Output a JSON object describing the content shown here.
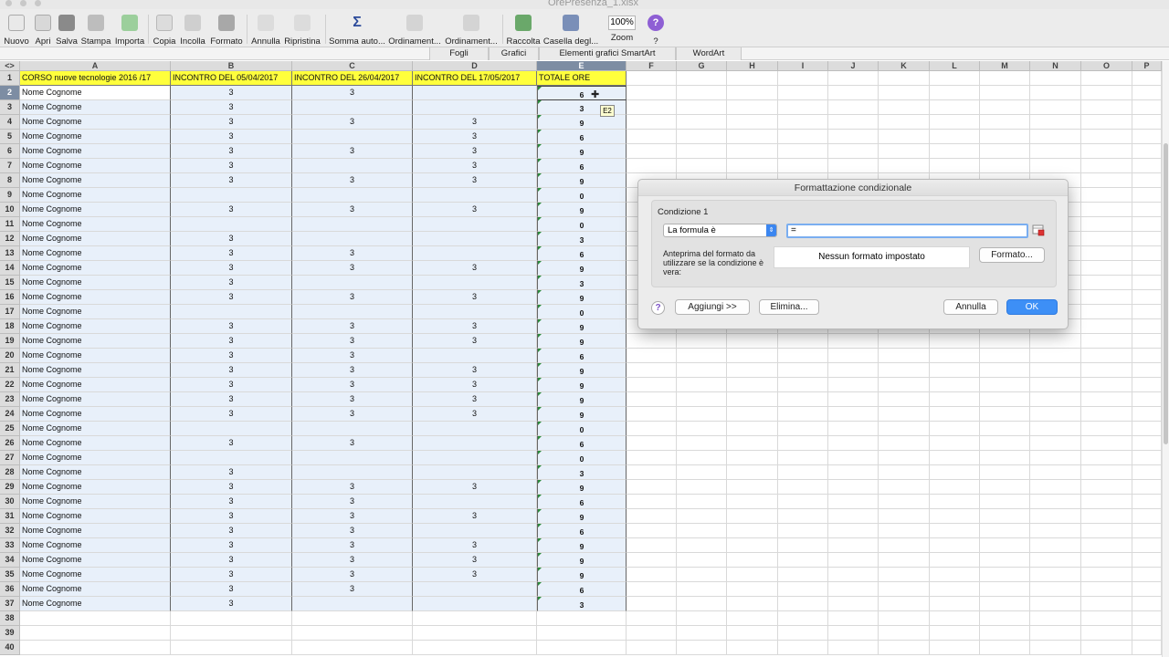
{
  "window": {
    "title": "OrePresenza_1.xlsx"
  },
  "toolbar": {
    "buttons": [
      {
        "label": "Nuovo",
        "icon": "new-document-icon"
      },
      {
        "label": "Apri",
        "icon": "open-folder-icon"
      },
      {
        "label": "Salva",
        "icon": "save-icon"
      },
      {
        "label": "Stampa",
        "icon": "print-icon"
      },
      {
        "label": "Importa",
        "icon": "import-icon"
      },
      {
        "label": "Copia",
        "icon": "copy-icon"
      },
      {
        "label": "Incolla",
        "icon": "paste-icon"
      },
      {
        "label": "Formato",
        "icon": "format-brush-icon"
      },
      {
        "label": "Annulla",
        "icon": "undo-icon"
      },
      {
        "label": "Ripristina",
        "icon": "redo-icon"
      },
      {
        "label": "Somma auto...",
        "icon": "sigma-icon"
      },
      {
        "label": "Ordinament...",
        "icon": "sort-ascending-icon"
      },
      {
        "label": "Ordinament...",
        "icon": "sort-descending-icon"
      },
      {
        "label": "Raccolta",
        "icon": "gallery-icon"
      },
      {
        "label": "Casella degl...",
        "icon": "toolbox-icon"
      },
      {
        "label": "Zoom",
        "icon": "zoom-icon"
      },
      {
        "label": "?",
        "icon": "help-icon"
      }
    ],
    "zoom_value": "100%"
  },
  "ribbon": {
    "tabs": [
      "Fogli",
      "Grafici",
      "Elementi grafici SmartArt",
      "WordArt"
    ]
  },
  "sheet": {
    "corner": "<>",
    "columns": [
      "A",
      "B",
      "C",
      "D",
      "E",
      "F",
      "G",
      "H",
      "I",
      "J",
      "K",
      "L",
      "M",
      "N",
      "O",
      "P"
    ],
    "headers": [
      "CORSO nuove tecnologie  2016 /17",
      "INCONTRO DEL 05/04/2017",
      "INCONTRO DEL 26/04/2017",
      "INCONTRO DEL 17/05/2017",
      "TOTALE ORE"
    ],
    "rows": [
      {
        "n": "2",
        "name": "Nome Cognome",
        "b": "3",
        "c": "3",
        "d": "",
        "e": "6"
      },
      {
        "n": "3",
        "name": "Nome Cognome",
        "b": "3",
        "c": "",
        "d": "",
        "e": "3"
      },
      {
        "n": "4",
        "name": "Nome Cognome",
        "b": "3",
        "c": "3",
        "d": "3",
        "e": "9"
      },
      {
        "n": "5",
        "name": "Nome Cognome",
        "b": "3",
        "c": "",
        "d": "3",
        "e": "6"
      },
      {
        "n": "6",
        "name": "Nome Cognome",
        "b": "3",
        "c": "3",
        "d": "3",
        "e": "9"
      },
      {
        "n": "7",
        "name": "Nome Cognome",
        "b": "3",
        "c": "",
        "d": "3",
        "e": "6"
      },
      {
        "n": "8",
        "name": "Nome Cognome",
        "b": "3",
        "c": "3",
        "d": "3",
        "e": "9"
      },
      {
        "n": "9",
        "name": "Nome Cognome",
        "b": "",
        "c": "",
        "d": "",
        "e": "0"
      },
      {
        "n": "10",
        "name": "Nome Cognome",
        "b": "3",
        "c": "3",
        "d": "3",
        "e": "9"
      },
      {
        "n": "11",
        "name": "Nome Cognome",
        "b": "",
        "c": "",
        "d": "",
        "e": "0"
      },
      {
        "n": "12",
        "name": "Nome Cognome",
        "b": "3",
        "c": "",
        "d": "",
        "e": "3"
      },
      {
        "n": "13",
        "name": "Nome Cognome",
        "b": "3",
        "c": "3",
        "d": "",
        "e": "6"
      },
      {
        "n": "14",
        "name": "Nome Cognome",
        "b": "3",
        "c": "3",
        "d": "3",
        "e": "9"
      },
      {
        "n": "15",
        "name": "Nome Cognome",
        "b": "3",
        "c": "",
        "d": "",
        "e": "3"
      },
      {
        "n": "16",
        "name": "Nome Cognome",
        "b": "3",
        "c": "3",
        "d": "3",
        "e": "9"
      },
      {
        "n": "17",
        "name": "Nome Cognome",
        "b": "",
        "c": "",
        "d": "",
        "e": "0"
      },
      {
        "n": "18",
        "name": "Nome Cognome",
        "b": "3",
        "c": "3",
        "d": "3",
        "e": "9"
      },
      {
        "n": "19",
        "name": "Nome Cognome",
        "b": "3",
        "c": "3",
        "d": "3",
        "e": "9"
      },
      {
        "n": "20",
        "name": "Nome Cognome",
        "b": "3",
        "c": "3",
        "d": "",
        "e": "6"
      },
      {
        "n": "21",
        "name": "Nome Cognome",
        "b": "3",
        "c": "3",
        "d": "3",
        "e": "9"
      },
      {
        "n": "22",
        "name": "Nome Cognome",
        "b": "3",
        "c": "3",
        "d": "3",
        "e": "9"
      },
      {
        "n": "23",
        "name": "Nome Cognome",
        "b": "3",
        "c": "3",
        "d": "3",
        "e": "9"
      },
      {
        "n": "24",
        "name": "Nome Cognome",
        "b": "3",
        "c": "3",
        "d": "3",
        "e": "9"
      },
      {
        "n": "25",
        "name": "Nome Cognome",
        "b": "",
        "c": "",
        "d": "",
        "e": "0"
      },
      {
        "n": "26",
        "name": "Nome Cognome",
        "b": "3",
        "c": "3",
        "d": "",
        "e": "6"
      },
      {
        "n": "27",
        "name": "Nome Cognome",
        "b": "",
        "c": "",
        "d": "",
        "e": "0"
      },
      {
        "n": "28",
        "name": "Nome Cognome",
        "b": "3",
        "c": "",
        "d": "",
        "e": "3"
      },
      {
        "n": "29",
        "name": "Nome Cognome",
        "b": "3",
        "c": "3",
        "d": "3",
        "e": "9"
      },
      {
        "n": "30",
        "name": "Nome Cognome",
        "b": "3",
        "c": "3",
        "d": "",
        "e": "6"
      },
      {
        "n": "31",
        "name": "Nome Cognome",
        "b": "3",
        "c": "3",
        "d": "3",
        "e": "9"
      },
      {
        "n": "32",
        "name": "Nome Cognome",
        "b": "3",
        "c": "3",
        "d": "",
        "e": "6"
      },
      {
        "n": "33",
        "name": "Nome Cognome",
        "b": "3",
        "c": "3",
        "d": "3",
        "e": "9"
      },
      {
        "n": "34",
        "name": "Nome Cognome",
        "b": "3",
        "c": "3",
        "d": "3",
        "e": "9"
      },
      {
        "n": "35",
        "name": "Nome Cognome",
        "b": "3",
        "c": "3",
        "d": "3",
        "e": "9"
      },
      {
        "n": "36",
        "name": "Nome Cognome",
        "b": "3",
        "c": "3",
        "d": "",
        "e": "6"
      },
      {
        "n": "37",
        "name": "Nome Cognome",
        "b": "3",
        "c": "",
        "d": "",
        "e": "3"
      }
    ],
    "empty_rows": [
      "38",
      "39",
      "40"
    ],
    "cell_ref_tooltip": "E2",
    "header_row_number": "1"
  },
  "dialog": {
    "title": "Formattazione condizionale",
    "condition_label": "Condizione 1",
    "condition_type": "La formula è",
    "formula_value": "=",
    "preview_label": "Anteprima del formato da utilizzare se la condizione è vera:",
    "preview_text": "Nessun formato impostato",
    "format_button": "Formato...",
    "add_button": "Aggiungi >>",
    "delete_button": "Elimina...",
    "cancel_button": "Annulla",
    "ok_button": "OK",
    "help": "?"
  },
  "colors": {
    "header_yellow": "#ffff3c",
    "data_fill": "#e8f0fa",
    "ok_blue": "#3d8ff6",
    "selected_header": "#7d8da3"
  }
}
